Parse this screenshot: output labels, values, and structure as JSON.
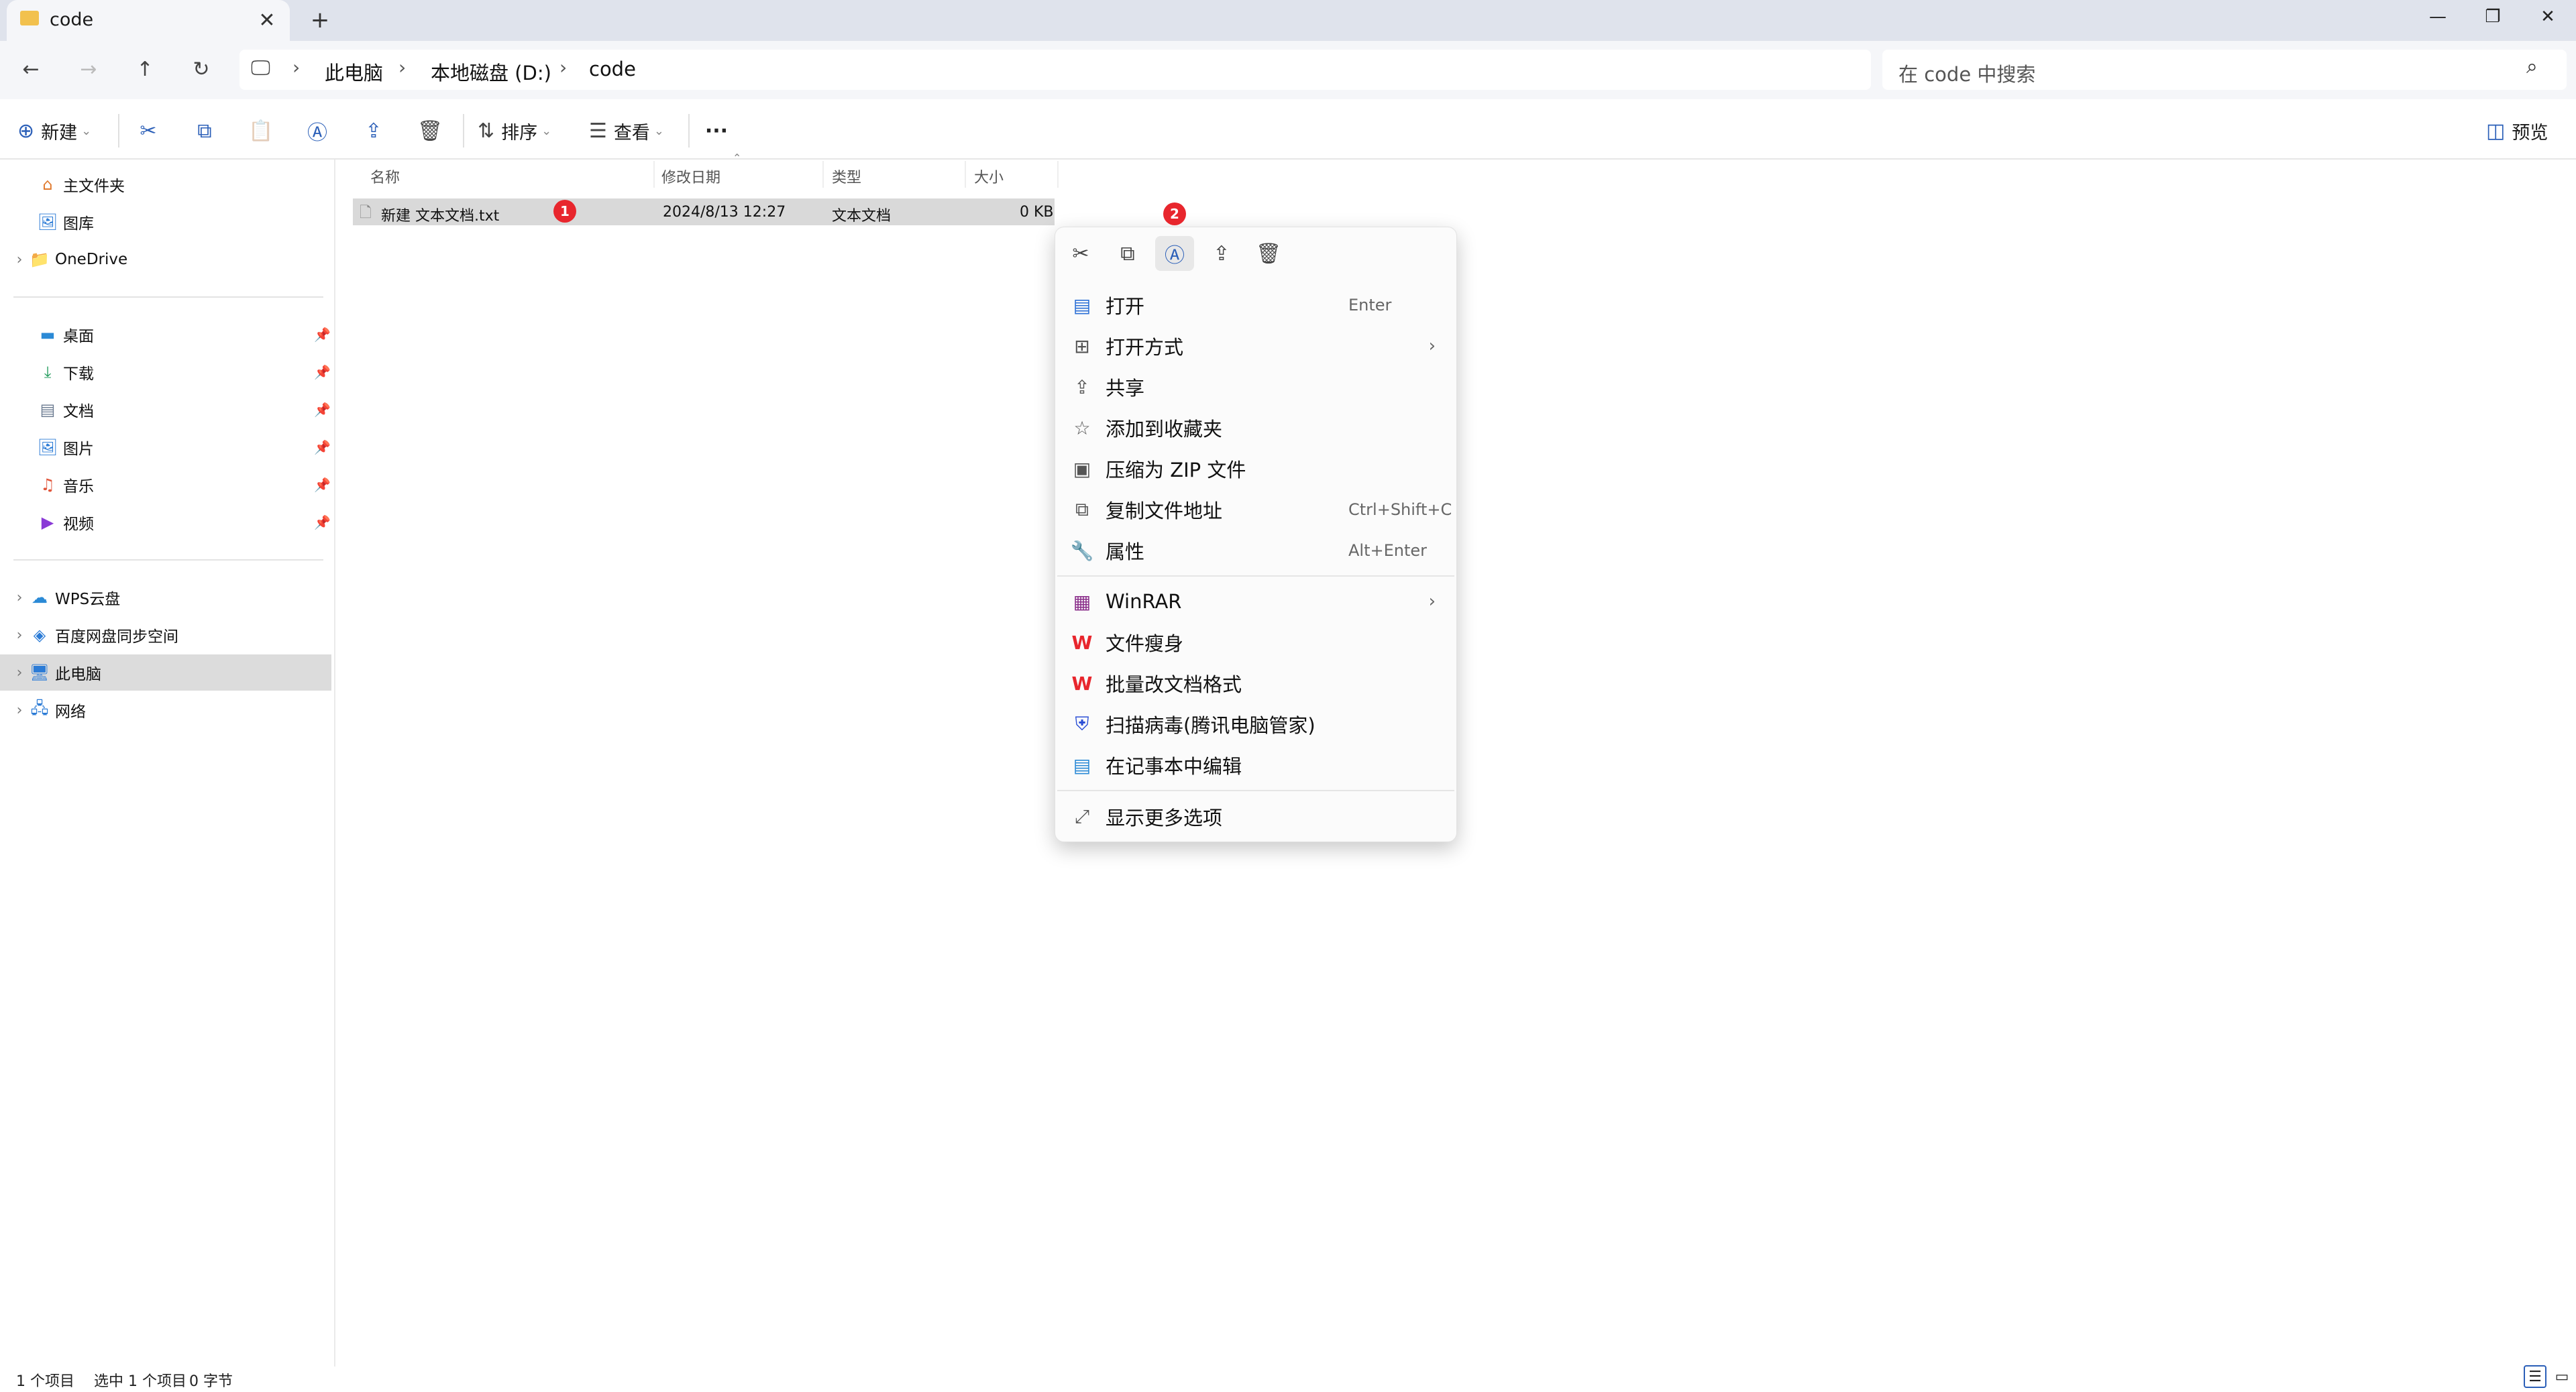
{
  "window": {
    "tab_title": "code",
    "tab_close": "✕",
    "new_tab": "+",
    "controls": {
      "minimize": "—",
      "restore": "❐",
      "close": "✕"
    }
  },
  "nav": {
    "back": "←",
    "forward": "→",
    "up": "↑",
    "refresh": "↻",
    "computer_icon": "🖵",
    "breadcrumbs": [
      "此电脑",
      "本地磁盘 (D:)",
      "code"
    ],
    "separator": "›",
    "search_placeholder": "在 code 中搜索",
    "search_icon": "⌕"
  },
  "toolbar": {
    "new_icon": "⊕",
    "new_label": "新建",
    "dropdown": "⌄",
    "cut_icon": "✂",
    "copy_icon": "⧉",
    "paste_icon": "📋",
    "rename_icon": "Ⓐ",
    "share_icon": "⇪",
    "delete_icon": "🗑",
    "sort_icon": "⇅",
    "sort_label": "排序",
    "view_icon": "☰",
    "view_label": "查看",
    "more": "···",
    "preview_icon": "◫",
    "preview_label": "预览"
  },
  "sidebar": {
    "items": [
      {
        "label": "主文件夹",
        "icon": "⌂",
        "chevron": ""
      },
      {
        "label": "图库",
        "icon": "🖼",
        "chevron": ""
      },
      {
        "label": "OneDrive",
        "icon": "📁",
        "chevron": "›"
      }
    ],
    "pinned": [
      {
        "label": "桌面",
        "icon": "▬"
      },
      {
        "label": "下载",
        "icon": "⤓"
      },
      {
        "label": "文档",
        "icon": "▤"
      },
      {
        "label": "图片",
        "icon": "🖼"
      },
      {
        "label": "音乐",
        "icon": "♫"
      },
      {
        "label": "视频",
        "icon": "▶"
      }
    ],
    "pin_icon": "📌",
    "locations": [
      {
        "label": "WPS云盘",
        "icon": "☁",
        "chevron": "›"
      },
      {
        "label": "百度网盘同步空间",
        "icon": "◈",
        "chevron": "›"
      },
      {
        "label": "此电脑",
        "icon": "🖥",
        "chevron": "›"
      },
      {
        "label": "网络",
        "icon": "🖧",
        "chevron": "›"
      }
    ]
  },
  "filelist": {
    "columns": [
      "名称",
      "修改日期",
      "类型",
      "大小"
    ],
    "sort_indicator": "⌃",
    "rows": [
      {
        "name": "新建 文本文档.txt",
        "date": "2024/8/13 12:27",
        "type": "文本文档",
        "size": "0 KB",
        "icon": "🗋"
      }
    ]
  },
  "badges": {
    "one": "1",
    "two": "2"
  },
  "context_menu": {
    "quick": {
      "cut": "✂",
      "copy": "⧉",
      "rename": "Ⓐ",
      "share": "⇪",
      "delete": "🗑"
    },
    "group1": [
      {
        "label": "打开",
        "shortcut": "Enter",
        "icon": "▤",
        "sub": ""
      },
      {
        "label": "打开方式",
        "shortcut": "",
        "icon": "⊞",
        "sub": "›"
      },
      {
        "label": "共享",
        "shortcut": "",
        "icon": "⇪",
        "sub": ""
      },
      {
        "label": "添加到收藏夹",
        "shortcut": "",
        "icon": "☆",
        "sub": ""
      },
      {
        "label": "压缩为 ZIP 文件",
        "shortcut": "",
        "icon": "▣",
        "sub": ""
      },
      {
        "label": "复制文件地址",
        "shortcut": "Ctrl+Shift+C",
        "icon": "⧉",
        "sub": ""
      },
      {
        "label": "属性",
        "shortcut": "Alt+Enter",
        "icon": "🔧",
        "sub": ""
      }
    ],
    "group2": [
      {
        "label": "WinRAR",
        "icon": "▦",
        "sub": "›"
      },
      {
        "label": "文件瘦身",
        "icon": "W",
        "sub": ""
      },
      {
        "label": "批量改文档格式",
        "icon": "W",
        "sub": ""
      },
      {
        "label": "扫描病毒(腾讯电脑管家)",
        "icon": "⛨",
        "sub": ""
      },
      {
        "label": "在记事本中编辑",
        "icon": "▤",
        "sub": ""
      }
    ],
    "group3": [
      {
        "label": "显示更多选项",
        "icon": "⤢",
        "sub": ""
      }
    ]
  },
  "status": {
    "count": "1 个项目",
    "selected": "选中 1 个项目",
    "size": "0 字节",
    "details_view_icon": "☰",
    "tiles_view_icon": "▭"
  },
  "colors": {
    "accent": "#2b5fb8",
    "badge": "#e8262d",
    "selection": "#d9d9d9",
    "wps_red": "#e8262d",
    "folder_yellow": "#f2c14e"
  }
}
